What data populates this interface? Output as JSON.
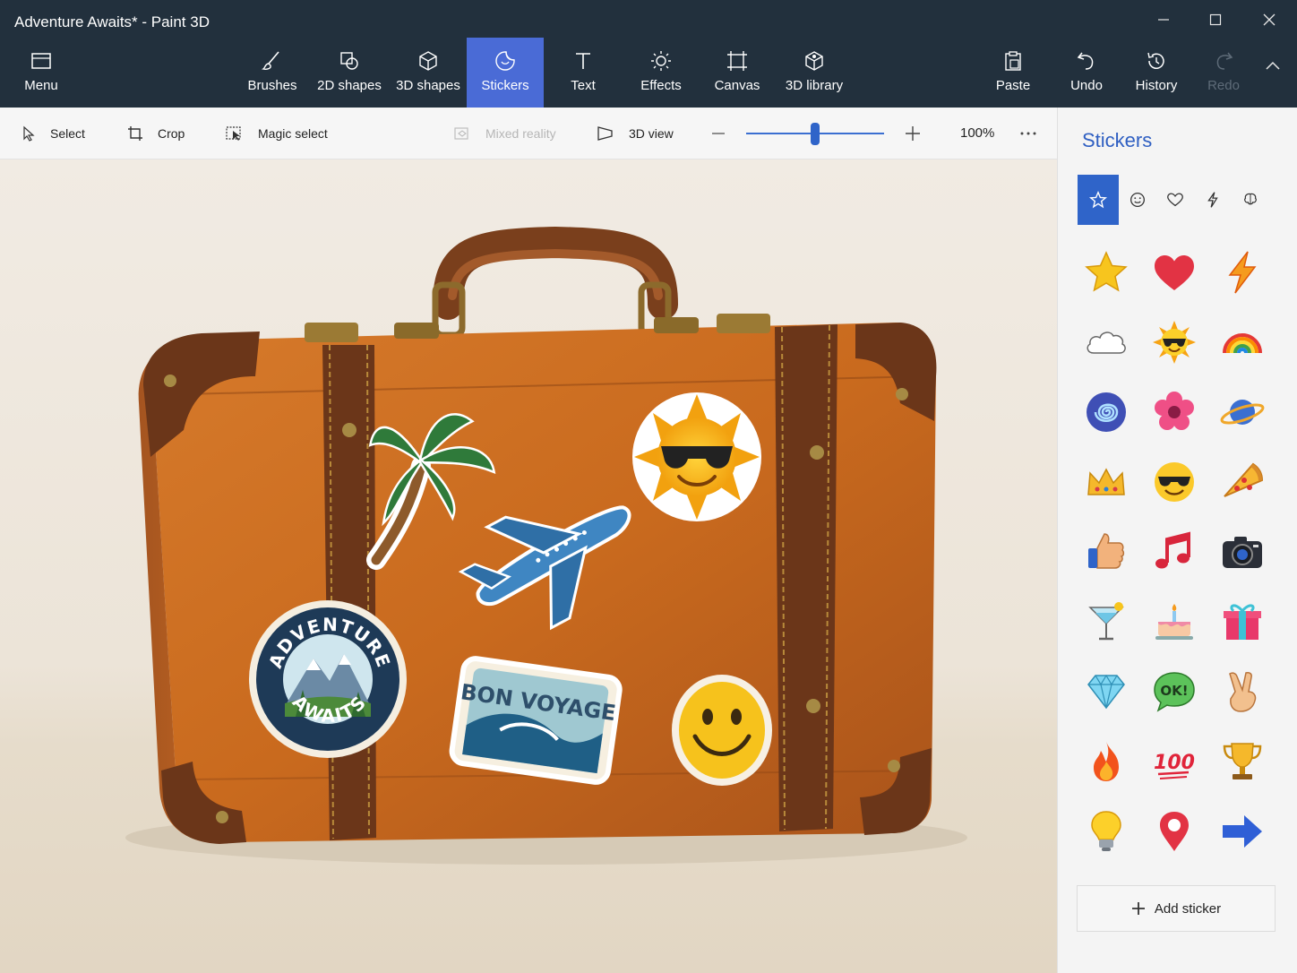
{
  "window": {
    "title": "Adventure Awaits* - Paint 3D"
  },
  "ribbon": {
    "menu": "Menu",
    "tools": [
      {
        "label": "Brushes",
        "icon": "brush-icon"
      },
      {
        "label": "2D shapes",
        "icon": "2d-shapes-icon"
      },
      {
        "label": "3D shapes",
        "icon": "3d-shapes-icon"
      },
      {
        "label": "Stickers",
        "icon": "stickers-icon",
        "active": true
      },
      {
        "label": "Text",
        "icon": "text-icon"
      },
      {
        "label": "Effects",
        "icon": "effects-icon"
      },
      {
        "label": "Canvas",
        "icon": "canvas-icon"
      },
      {
        "label": "3D library",
        "icon": "3d-library-icon"
      }
    ],
    "actions": [
      {
        "label": "Paste",
        "icon": "paste-icon"
      },
      {
        "label": "Undo",
        "icon": "undo-icon"
      },
      {
        "label": "History",
        "icon": "history-icon"
      },
      {
        "label": "Redo",
        "icon": "redo-icon",
        "disabled": true
      }
    ]
  },
  "toolbar": {
    "select": "Select",
    "crop": "Crop",
    "magic_select": "Magic select",
    "mixed_reality": "Mixed reality",
    "view_3d": "3D view",
    "zoom": "100%",
    "zoom_level": 0.5
  },
  "canvas": {
    "sticker_texts": {
      "adventure_top": "ADVENTURE",
      "adventure_bottom": "AWAITS",
      "bon_voyage": "BON VOYAGE"
    }
  },
  "panel": {
    "title": "Stickers",
    "categories": [
      "star-icon",
      "smiley-icon",
      "heart-icon",
      "lightning-icon",
      "brain-icon"
    ],
    "stickers": [
      "star-sticker",
      "heart-sticker",
      "lightning-sticker",
      "cloud-sticker",
      "sun-sunglasses-sticker",
      "rainbow-sticker",
      "spiral-sticker",
      "flower-sticker",
      "planet-sticker",
      "crown-sticker",
      "cool-face-sticker",
      "pizza-sticker",
      "thumbs-up-sticker",
      "music-note-sticker",
      "camera-sticker",
      "cocktail-sticker",
      "cake-sticker",
      "gift-sticker",
      "diamond-sticker",
      "ok-bubble-sticker",
      "peace-hand-sticker",
      "fire-sticker",
      "hundred-sticker",
      "trophy-sticker",
      "lightbulb-sticker",
      "map-pin-sticker",
      "arrow-right-sticker"
    ],
    "hundred_text": "100",
    "ok_text": "OK!",
    "add_sticker": "Add sticker"
  },
  "colors": {
    "ribbon_bg": "#22303d",
    "accent": "#4a6bd6",
    "panel_title": "#2f5fc2"
  }
}
